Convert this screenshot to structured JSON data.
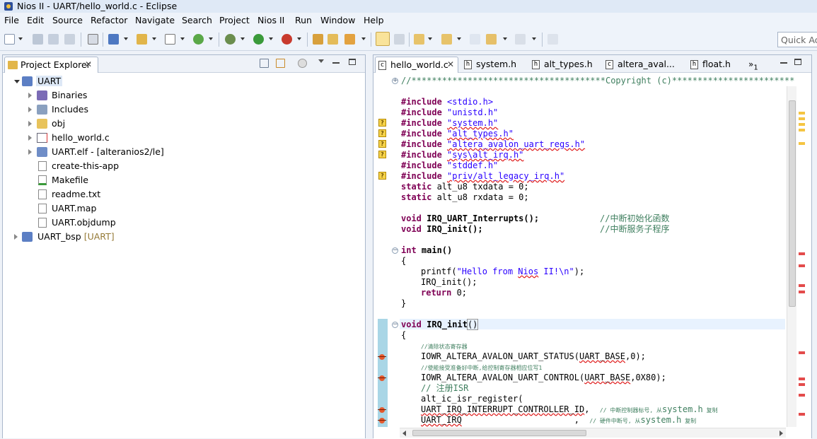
{
  "window": {
    "title": "Nios II - UART/hello_world.c - Eclipse"
  },
  "menu": [
    "File",
    "Edit",
    "Source",
    "Refactor",
    "Navigate",
    "Search",
    "Project",
    "Nios II",
    "Run",
    "Window",
    "Help"
  ],
  "toolbar": {
    "quick_access_placeholder": "Quick Access"
  },
  "project_explorer": {
    "tab_label": "Project Explorer",
    "tree": [
      {
        "label": "UART",
        "decoration": "",
        "icon": "project-icon"
      },
      {
        "label": "Binaries",
        "decoration": "",
        "icon": "binaries-icon"
      },
      {
        "label": "Includes",
        "decoration": "",
        "icon": "includes-icon"
      },
      {
        "label": "obj",
        "decoration": "",
        "icon": "folder-icon"
      },
      {
        "label": "hello_world.c",
        "decoration": "",
        "icon": "c-file-icon"
      },
      {
        "label": "UART.elf - [alteranios2/le]",
        "decoration": "",
        "icon": "elf-file-icon"
      },
      {
        "label": "create-this-app",
        "decoration": "",
        "icon": "file-icon"
      },
      {
        "label": "Makefile",
        "decoration": "",
        "icon": "makefile-icon"
      },
      {
        "label": "readme.txt",
        "decoration": "",
        "icon": "text-file-icon"
      },
      {
        "label": "UART.map",
        "decoration": "",
        "icon": "file-icon"
      },
      {
        "label": "UART.objdump",
        "decoration": "",
        "icon": "file-icon"
      },
      {
        "label": "UART_bsp",
        "decoration": "[UART]",
        "icon": "project-icon"
      }
    ]
  },
  "editor": {
    "tabs": [
      {
        "label": "hello_world.c",
        "active": true
      },
      {
        "label": "system.h",
        "active": false
      },
      {
        "label": "alt_types.h",
        "active": false
      },
      {
        "label": "altera_aval...",
        "active": false
      },
      {
        "label": "float.h",
        "active": false
      }
    ],
    "overflow_count": "1",
    "code": {
      "l1": "//**************************************Copyright (c)************************",
      "inc1_a": "#include ",
      "inc1_b": "<stdio.h>",
      "inc2_a": "#include ",
      "inc2_b": "\"unistd.h\"",
      "inc3_a": "#include ",
      "inc3_b": "\"system.h\"",
      "inc4_a": "#include ",
      "inc4_b": "\"alt_types.h\"",
      "inc5_a": "#include ",
      "inc5_b": "\"altera_avalon_uart_regs.h\"",
      "inc6_a": "#include ",
      "inc6_b": "\"sys\\alt_irq.h\"",
      "inc7_a": "#include ",
      "inc7_b": "\"stddef.h\"",
      "inc8_a": "#include ",
      "inc8_b": "\"priv/alt_legacy_irq.h\"",
      "s1_a": "static",
      "s1_b": " alt_u8 txdata = 0;",
      "s2_a": "static",
      "s2_b": " alt_u8 rxdata = 0;",
      "v1_a": "void",
      "v1_b": " IRQ_UART_Interrupts();",
      "v1_c": "//中断初始化函数",
      "v2_a": "void",
      "v2_b": " IRQ_init();",
      "v2_c": "//中断服务子程序",
      "m1_a": "int",
      "m1_b": " main()",
      "m2": "{",
      "m3_a": "printf(",
      "m3_b": "\"Hello from ",
      "m3_c": "Nios",
      "m3_d": " II!\\n\"",
      "m3_e": ");",
      "m4": "IRQ_init();",
      "m5_a": "return",
      "m5_b": " 0;",
      "m6": "}",
      "f1_a": "void",
      "f1_b": " IRQ_init",
      "f1_c": "()",
      "f2": "{",
      "f3": "//清除状态寄存器",
      "f4_a": "IOWR_ALTERA_AVALON_UART_STATUS(",
      "f4_b": "UART_BASE",
      "f4_c": ",0);",
      "f5": "//使能接受准备好中断,给控制寄存器相应位写1",
      "f6_a": "IOWR_ALTERA_AVALON_UART_CONTROL(",
      "f6_b": "UART_BASE",
      "f6_c": ",0X80);",
      "f7": "// 注册ISR",
      "f8": "alt_ic_isr_register(",
      "f9_a": "UART_IRQ_INTERRUPT_CONTROLLER_ID",
      "f9_b": ",  ",
      "f9_c": "// 中断控制器标号, 从",
      "f9_d": "system.h",
      "f9_e": " 复制",
      "f10_a": "UART_IRQ",
      "f10_b": "                      ,  ",
      "f10_c": "// 硬件中断号, 从",
      "f10_d": "system.h",
      "f10_e": " 复制"
    }
  }
}
